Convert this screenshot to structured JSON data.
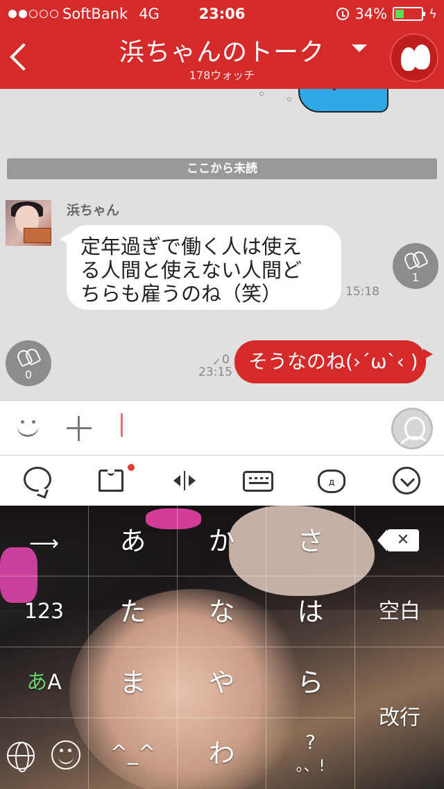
{
  "status_bar": {
    "carrier": "SoftBank",
    "network": "4G",
    "time": "23:06",
    "battery": "34%",
    "battery_level": 0.34
  },
  "header": {
    "title": "浜ちゃんのトーク",
    "subtitle": "178ウォッチ"
  },
  "chat": {
    "unread_divider": "ここから未読",
    "incoming": {
      "sender": "浜ちゃん",
      "lines": [
        "定年過ぎで働く人は使え",
        "る人間と使えない人間ど",
        "ちらも雇うのね（笑）"
      ],
      "time": "15:18",
      "clap_count": "1"
    },
    "outgoing": {
      "text": "そうなのね(›´ω`‹ )",
      "time": "23:15",
      "read_mark": "✓",
      "read_count": "0",
      "clap_count": "0"
    }
  },
  "input_bar": {
    "value": ""
  },
  "toolbar": {
    "icons": [
      "chat-bubble-icon",
      "shirt-icon",
      "cursor-move-icon",
      "keyboard-icon",
      "cat-emoticon-icon",
      "chevron-down-icon"
    ],
    "cat_face": "д"
  },
  "keyboard": {
    "row1": [
      "あ",
      "か",
      "さ"
    ],
    "row2": [
      "123",
      "た",
      "な",
      "は",
      "空白"
    ],
    "row3_mode": {
      "kana": "あ",
      "latin": "A"
    },
    "row3": [
      "ま",
      "や",
      "ら"
    ],
    "row4": [
      "^_^",
      "わ"
    ],
    "punct_top": "?",
    "punct_bottom": "。、!",
    "enter": "改行"
  },
  "colors": {
    "brand_red": "#d42a2a",
    "chat_bg": "#e0e0e0",
    "battery_green": "#5be05b"
  }
}
